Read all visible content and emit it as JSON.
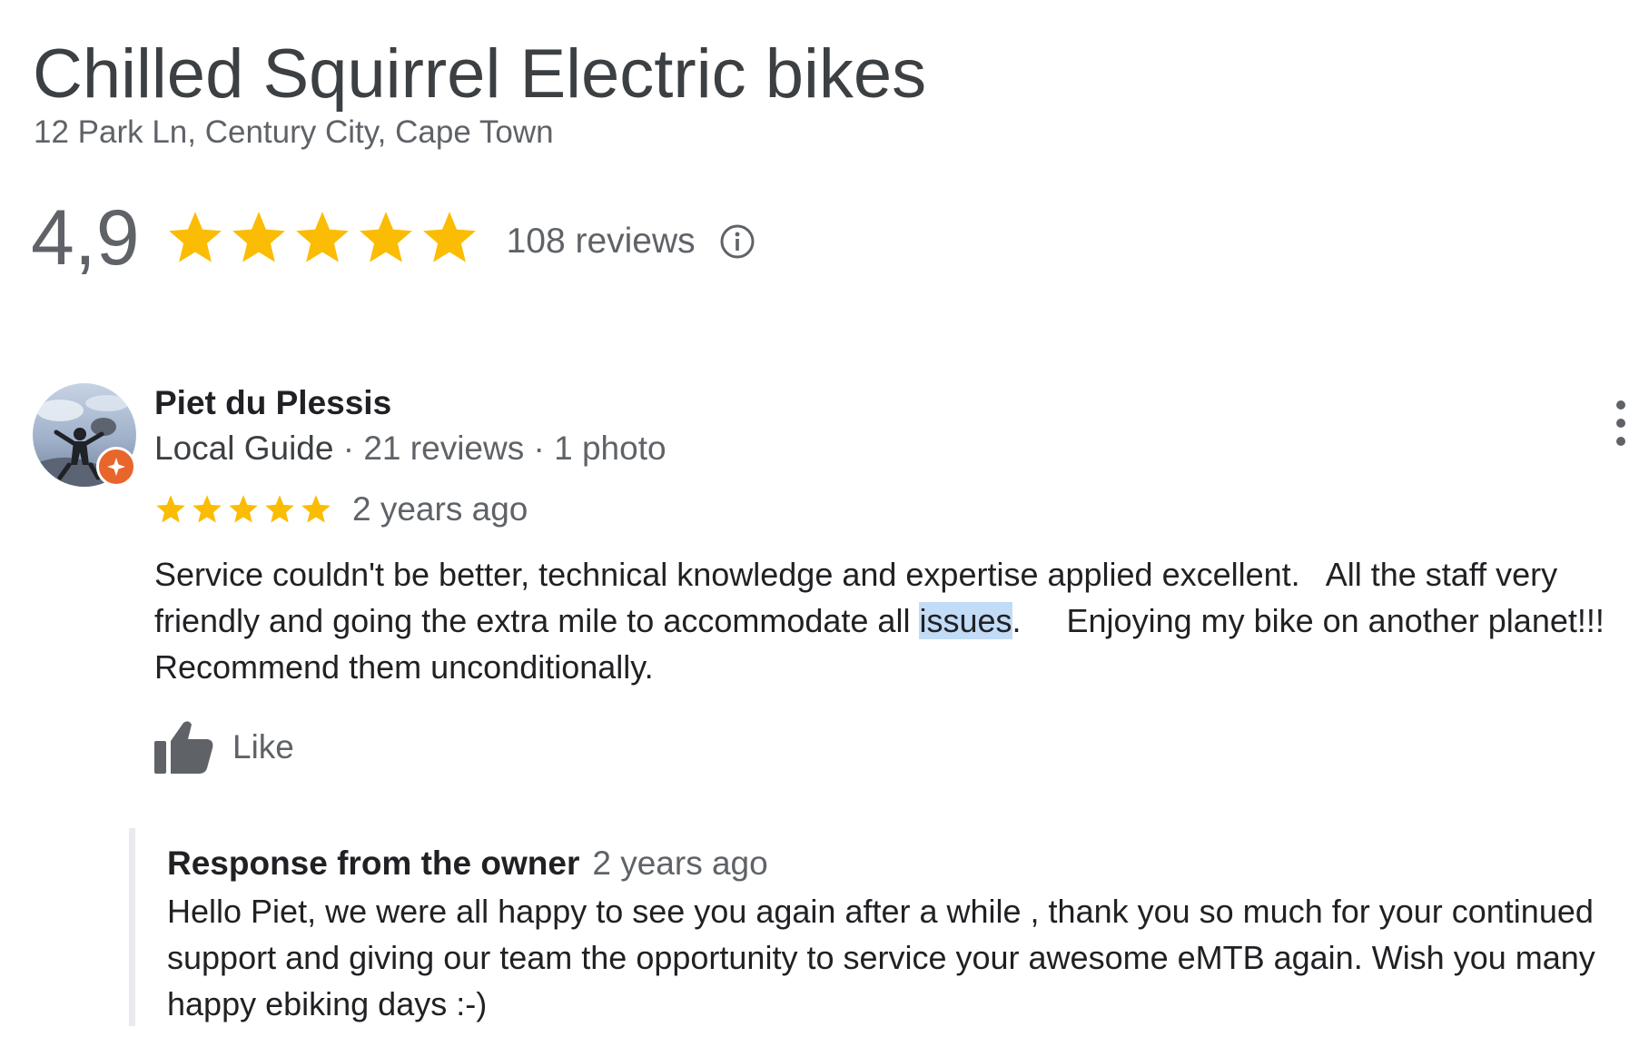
{
  "business": {
    "name": "Chilled Squirrel Electric bikes",
    "address": "12 Park Ln, Century City, Cape Town",
    "rating": "4,9",
    "rating_value": 4.9,
    "review_count": "108 reviews",
    "star_color": "#fbbc04",
    "info_icon": "info-circle-icon"
  },
  "review": {
    "reviewer_name": "Piet du Plessis",
    "reviewer_badge": "Local Guide",
    "reviewer_reviews": "21 reviews",
    "reviewer_photos": "1 photo",
    "meta_separator": "·",
    "stars": 5,
    "date": "2 years ago",
    "text_lines": {
      "l1": "Service couldn't be better, technical knowledge and expertise applied excellent.   All the staff very",
      "l2_before": "friendly and going the extra mile to accommodate all ",
      "l2_highlight": "issues",
      "l2_after": ".     Enjoying my bike on another planet!!!",
      "l3": "Recommend them unconditionally."
    },
    "highlight_color": "#c2dbf6",
    "like_label": "Like",
    "more_icon": "more-vertical-icon"
  },
  "owner_response": {
    "title": "Response from the owner",
    "date": "2 years ago",
    "text_lines": {
      "l1": "Hello Piet, we were all happy to see you again after a while , thank you so much for your continued",
      "l2": "support and giving our team the opportunity to service your awesome eMTB again. Wish you many",
      "l3": "happy ebiking days :-)"
    }
  }
}
